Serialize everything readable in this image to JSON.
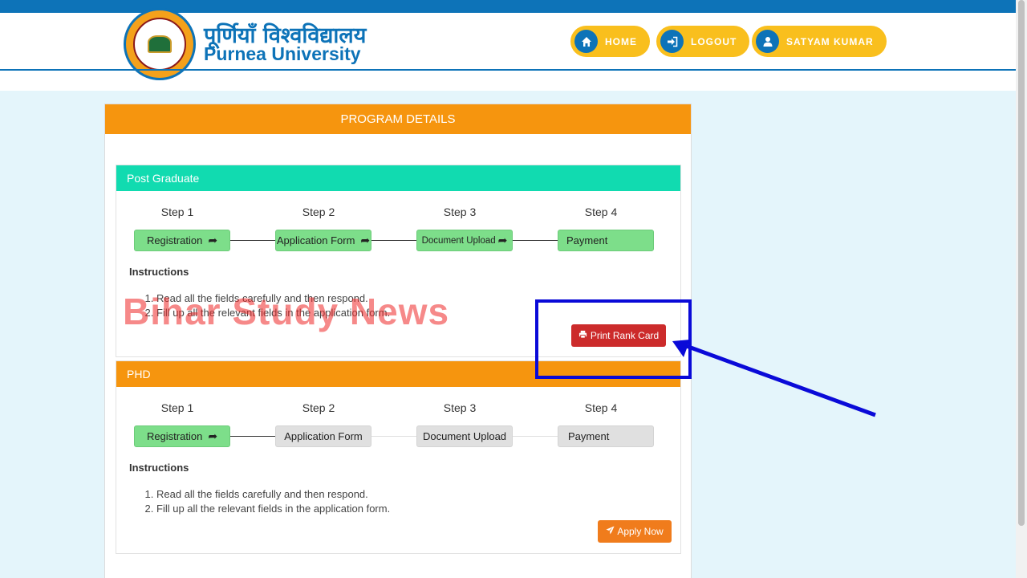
{
  "header": {
    "title_hindi": "पूर्णियाँ विश्वविद्यालय",
    "title_en": "Purnea University",
    "nav": [
      {
        "label": "HOME",
        "icon": "home-icon"
      },
      {
        "label": "LOGOUT",
        "icon": "sign-in-icon"
      },
      {
        "label": "SATYAM KUMAR",
        "icon": "user-icon"
      }
    ]
  },
  "panel": {
    "title": "PROGRAM DETAILS"
  },
  "post_graduate": {
    "title": "Post Graduate",
    "color": "#11dbb0",
    "steps": [
      {
        "label": "Step 1",
        "name": "Registration",
        "status": "done"
      },
      {
        "label": "Step 2",
        "name": "Application Form",
        "status": "done"
      },
      {
        "label": "Step 3",
        "name": "Document Upload",
        "status": "done"
      },
      {
        "label": "Step 4",
        "name": "Payment",
        "status": "done"
      }
    ],
    "instructions_title": "Instructions",
    "instructions": [
      "Read all the fields carefully and then respond.",
      "Fill up all the relevant fields in the application form."
    ],
    "action_label": "Print Rank Card",
    "action_icon": "print-icon"
  },
  "phd": {
    "title": "PHD",
    "color": "#f6950e",
    "steps": [
      {
        "label": "Step 1",
        "name": "Registration",
        "status": "done"
      },
      {
        "label": "Step 2",
        "name": "Application Form",
        "status": "todo"
      },
      {
        "label": "Step 3",
        "name": "Document Upload",
        "status": "todo"
      },
      {
        "label": "Step 4",
        "name": "Payment",
        "status": "todo"
      }
    ],
    "instructions_title": "Instructions",
    "instructions": [
      "Read all the fields carefully and then respond.",
      "Fill up all the relevant fields in the application form."
    ],
    "action_label": "Apply Now",
    "action_icon": "paper-plane-icon"
  },
  "overlay": {
    "watermark": "Bihar Study News",
    "highlight_color": "#0a0ad8"
  },
  "colors": {
    "brand_blue": "#0d73b8",
    "brand_orange": "#f6950e",
    "nav_yellow": "#f9bf1d",
    "step_done": "#7dde8a",
    "step_todo": "#e0e0e0",
    "print_red": "#cc2b2b"
  }
}
